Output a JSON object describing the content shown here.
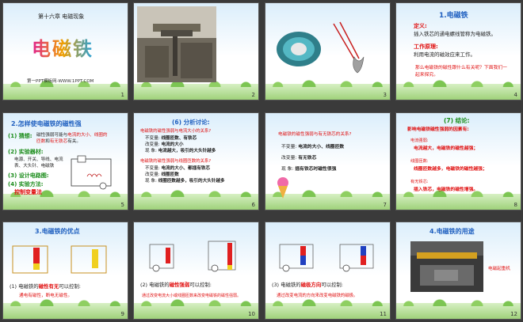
{
  "slides": [
    {
      "num": "1",
      "chapter": "第十六章 电磁现象",
      "title": "电磁铁",
      "footer": "第一PPT模板网-WWW.1PPT.COM"
    },
    {
      "num": "2"
    },
    {
      "num": "3"
    },
    {
      "num": "4",
      "title": "1.电磁铁",
      "def_label": "定义:",
      "def_text": "插入铁芯的通电螺线管称为电磁铁。",
      "work_label": "工作原理:",
      "work_text": "利用电流的磁效应来工作。",
      "question": "那么电磁铁的磁性跟什么有关呢？下面我们一起来探究。"
    },
    {
      "num": "5",
      "title": "2.怎样使电磁铁的磁性强",
      "i1": "(1) 猜想:",
      "i1b": "磁性强弱可能与",
      "i1c": "电流的大小、线圈的",
      "i1d": "匝数",
      "i1e": "和",
      "i1f": "有无铁芯",
      "i1g": "有关。",
      "i2": "(2) 实验器材:",
      "i2b": "电源、开关、导线、电流表、大头针、电磁铁",
      "i3": "(3) 设计电路图:",
      "i4": "(4) 实验方法:",
      "i4b": "控制变量法"
    },
    {
      "num": "6",
      "title": "(6) 分析讨论:",
      "q1": "电磁铁的磁性强弱与电流大小的关系?",
      "r1a": "不变量:",
      "r1b": "线圈匝数、有铁芯",
      "r2a": "改变量:",
      "r2b": "电流的大小",
      "r3a": "现  象:",
      "r3b": "电流越大，吸引的大头针越多",
      "q2": "电磁铁的磁性强弱与线圈匝数的关系?",
      "s1a": "不变量:",
      "s1b": "电流的大小、都插有铁芯",
      "s2a": "改变量:",
      "s2b": "线圈匝数",
      "s3a": "现  象:",
      "s3b": "线圈匝数越多，吸引的大头针越多"
    },
    {
      "num": "7",
      "q": "电磁铁的磁性强弱与有无铁芯的关系?",
      "a1": "不变量:",
      "a1b": "电流的大小、线圈匝数",
      "a2": "改变量:",
      "a2b": "有无铁芯",
      "a3": "现  象:",
      "a3b": "插有铁芯时磁性很强"
    },
    {
      "num": "8",
      "title": "(7) 结论:",
      "head": "影响电磁铁磁性强弱的因素有:",
      "c1": "电流越大，",
      "c1b": "电磁铁的磁性越强；",
      "c2": "线圈匝数越多，",
      "c2b": "电磁铁的磁性越强；",
      "c3": "插入铁芯，",
      "c3b": "电磁铁的磁性增强。",
      "l1": "电流强弱:",
      "l2": "线圈匝数:",
      "l3": "有无铁芯:"
    },
    {
      "num": "9",
      "title": "3.电磁铁的优点",
      "cap_a": "(1) 电磁铁的",
      "cap_b": "磁性有无",
      "cap_c": "可以控制:",
      "sub": "通电有磁性，断电无磁性。"
    },
    {
      "num": "10",
      "cap_a": "(2) 电磁铁的",
      "cap_b": "磁性强弱",
      "cap_c": "可以控制:",
      "sub": "通过改变电流大小或线圈匝数来改变电磁铁的磁性强弱。"
    },
    {
      "num": "11",
      "cap_a": "(3) 电磁铁的",
      "cap_b": "磁极方向",
      "cap_c": "可以控制:",
      "sub": "通过改变电流的方向来改变电磁铁的磁极。"
    },
    {
      "num": "12",
      "title": "4.电磁铁的用途",
      "side": "电磁起重机"
    }
  ],
  "colors": {
    "accent": "#e01010",
    "title_blue": "#2060c0",
    "green": "#1a8c1a",
    "selection": "#f0c000"
  }
}
